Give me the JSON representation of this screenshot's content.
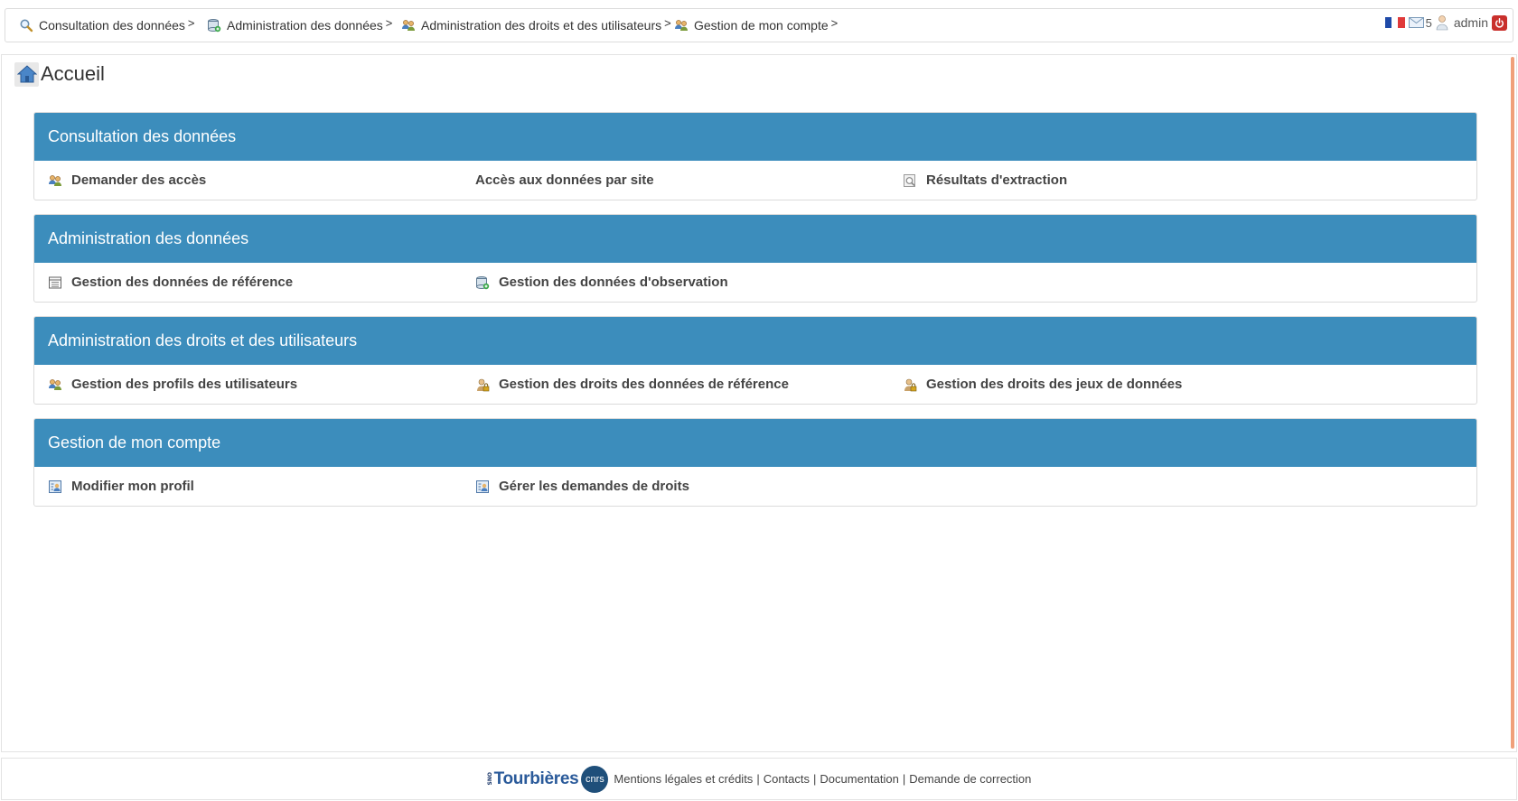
{
  "topnav": {
    "items": [
      {
        "label": "Consultation des données",
        "icon": "search-icon"
      },
      {
        "label": "Administration des données",
        "icon": "database-icon"
      },
      {
        "label": "Administration des droits et des utilisateurs",
        "icon": "users-icon"
      },
      {
        "label": "Gestion de mon compte",
        "icon": "users-icon"
      }
    ],
    "chevron": ">",
    "message_count": "5",
    "username": "admin",
    "flag": "french-flag-icon"
  },
  "page": {
    "title": "Accueil"
  },
  "sections": [
    {
      "title": "Consultation des données",
      "links": [
        {
          "label": "Demander des accès",
          "icon": "users-icon"
        },
        {
          "label": "Accès aux données par site",
          "icon": ""
        },
        {
          "label": "Résultats d'extraction",
          "icon": "magnifier-document-icon"
        }
      ]
    },
    {
      "title": "Administration des données",
      "links": [
        {
          "label": "Gestion des données de référence",
          "icon": "table-icon"
        },
        {
          "label": "Gestion des données d'observation",
          "icon": "database-icon"
        }
      ]
    },
    {
      "title": "Administration des droits et des utilisateurs",
      "links": [
        {
          "label": "Gestion des profils des utilisateurs",
          "icon": "users-icon"
        },
        {
          "label": "Gestion des droits des données de référence",
          "icon": "user-lock-icon"
        },
        {
          "label": "Gestion des droits des jeux de données",
          "icon": "user-lock-icon"
        }
      ]
    },
    {
      "title": "Gestion de mon compte",
      "links": [
        {
          "label": "Modifier mon profil",
          "icon": "profile-card-icon"
        },
        {
          "label": "Gérer les demandes de droits",
          "icon": "profile-card-icon"
        }
      ]
    }
  ],
  "footer": {
    "logo_sno": "SNO",
    "logo_text": "Tourbières",
    "cnrs": "cnrs",
    "links": [
      "Mentions légales et crédits",
      "Contacts",
      "Documentation",
      "Demande de correction"
    ],
    "separator": "|"
  },
  "colors": {
    "panel_header": "#3c8dbc",
    "scroll_accent": "#f0a07a",
    "power_button": "#c9302c"
  }
}
